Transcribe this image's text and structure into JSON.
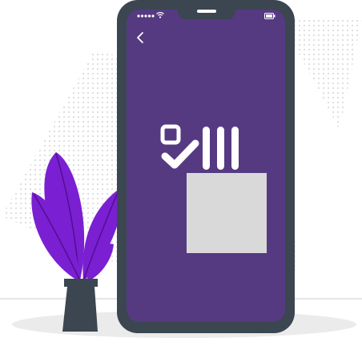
{
  "illustration": {
    "background_dots_color": "#d9dcdf",
    "floor_shadow_color": "#ebebeb",
    "plant": {
      "leaf_color": "#7a1fd1",
      "leaf_shade_color": "#4f0e8f",
      "pot_color": "#3b4650"
    }
  },
  "phone": {
    "frame_color": "#3b4650",
    "screen_color": "#553a82",
    "status_bar": {
      "signal_icon": "signal-dots-icon",
      "wifi_icon": "wifi-icon",
      "battery_icon": "battery-icon"
    },
    "back_icon": "chevron-left-icon",
    "content": {
      "checklist_icon": "checkbox-check-bars-icon",
      "placeholder_color": "#d9d9d9"
    }
  }
}
